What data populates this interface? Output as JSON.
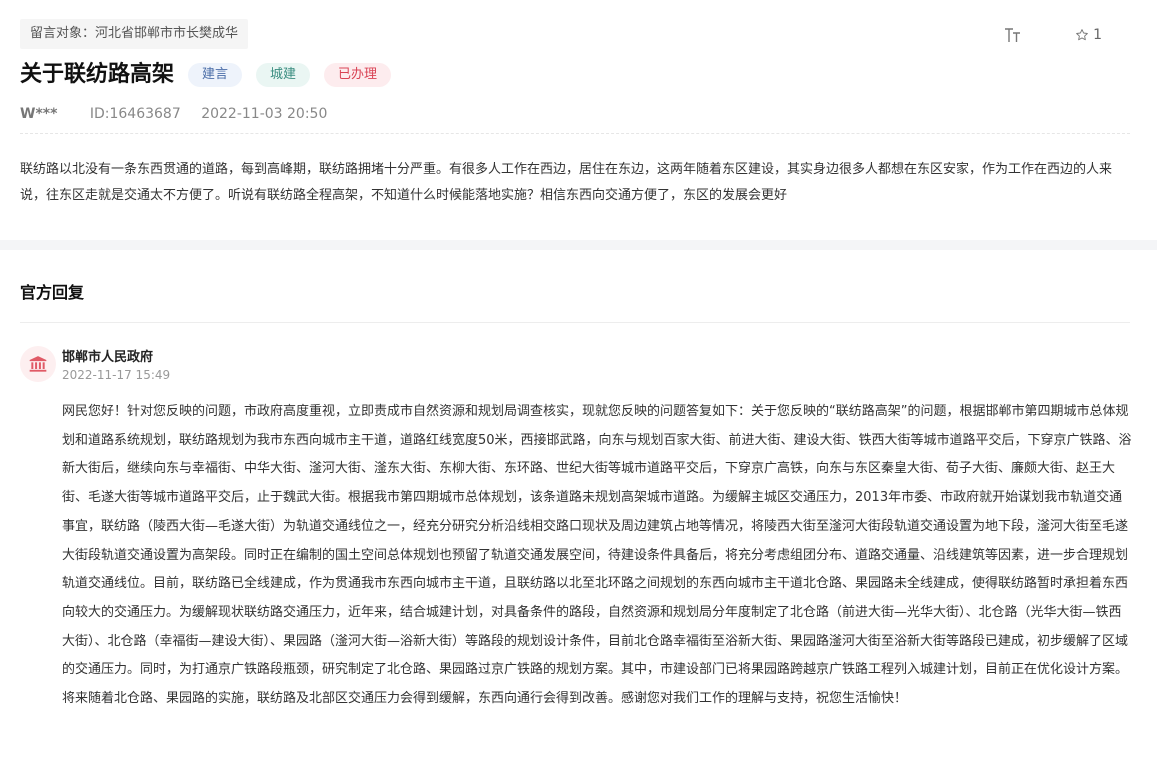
{
  "message": {
    "target": "留言对象：河北省邯郸市市长樊成华",
    "title": "关于联纺路高架",
    "tags": [
      "建言",
      "城建",
      "已办理"
    ],
    "author": "W***",
    "id": "ID:16463687",
    "datetime": "2022-11-03 20:50",
    "content": "联纺路以北没有一条东西贯通的道路，每到高峰期，联纺路拥堵十分严重。有很多人工作在西边，居住在东边，这两年随着东区建设，其实身边很多人都想在东区安家，作为工作在西边的人来说，往东区走就是交通太不方便了。听说有联纺路全程高架，不知道什么时候能落地实施？相信东西向交通方便了，东区的发展会更好"
  },
  "toolbar": {
    "font_icon": "font-size-icon",
    "star_icon": "star-icon",
    "star_count": "1"
  },
  "reply": {
    "heading": "官方回复",
    "org_icon": "government-building-icon",
    "org": "邯郸市人民政府",
    "datetime": "2022-11-17 15:49",
    "body": "网民您好！针对您反映的问题，市政府高度重视，立即责成市自然资源和规划局调查核实，现就您反映的问题答复如下：关于您反映的“联纺路高架”的问题，根据邯郸市第四期城市总体规划和道路系统规划，联纺路规划为我市东西向城市主干道，道路红线宽度50米，西接邯武路，向东与规划百家大街、前进大街、建设大街、铁西大街等城市道路平交后，下穿京广铁路、浴新大街后，继续向东与幸福街、中华大街、滏河大街、滏东大街、东柳大街、东环路、世纪大街等城市道路平交后，下穿京广高铁，向东与东区秦皇大街、荀子大街、廉颇大街、赵王大街、毛遂大街等城市道路平交后，止于魏武大街。根据我市第四期城市总体规划，该条道路未规划高架城市道路。为缓解主城区交通压力，2013年市委、市政府就开始谋划我市轨道交通事宜，联纺路（陵西大街—毛遂大街）为轨道交通线位之一，经充分研究分析沿线相交路口现状及周边建筑占地等情况，将陵西大街至滏河大街段轨道交通设置为地下段，滏河大街至毛遂大街段轨道交通设置为高架段。同时正在编制的国土空间总体规划也预留了轨道交通发展空间，待建设条件具备后，将充分考虑组团分布、道路交通量、沿线建筑等因素，进一步合理规划轨道交通线位。目前，联纺路已全线建成，作为贯通我市东西向城市主干道，且联纺路以北至北环路之间规划的东西向城市主干道北仓路、果园路未全线建成，使得联纺路暂时承担着东西向较大的交通压力。为缓解现状联纺路交通压力，近年来，结合城建计划，对具备条件的路段，自然资源和规划局分年度制定了北仓路（前进大街—光华大街）、北仓路（光华大街—铁西大街）、北仓路（幸福街—建设大街）、果园路（滏河大街—浴新大街）等路段的规划设计条件，目前北仓路幸福街至浴新大街、果园路滏河大街至浴新大街等路段已建成，初步缓解了区域的交通压力。同时，为打通京广铁路段瓶颈，研究制定了北仓路、果园路过京广铁路的规划方案。其中，市建设部门已将果园路跨越京广铁路工程列入城建计划，目前正在优化设计方案。将来随着北仓路、果园路的实施，联纺路及北部区交通压力会得到缓解，东西向通行会得到改善。感谢您对我们工作的理解与支持，祝您生活愉快！"
  }
}
